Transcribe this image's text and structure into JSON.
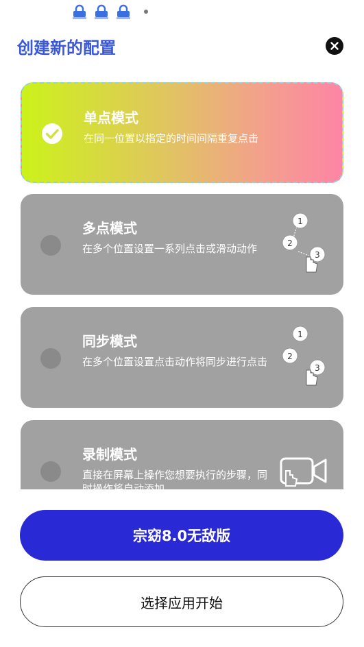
{
  "header": {
    "title": "创建新的配置",
    "close_icon": "close-icon"
  },
  "modes": [
    {
      "title": "单点模式",
      "description": "在同一位置以指定的时间间隔重复点击",
      "selected": true,
      "icon": "check-icon"
    },
    {
      "title": "多点模式",
      "description": "在多个位置设置一系列点击或滑动动作",
      "selected": false,
      "icon": "multi-tap-icon",
      "step_labels": [
        "1",
        "2",
        "3"
      ]
    },
    {
      "title": "同步模式",
      "description": "在多个位置设置点击动作将同步进行点击",
      "selected": false,
      "icon": "sync-tap-icon",
      "step_labels": [
        "1",
        "2",
        "3"
      ]
    },
    {
      "title": "录制模式",
      "description": "直接在屏幕上操作您想要执行的步骤，同时操作将自动添加",
      "selected": false,
      "icon": "record-icon"
    }
  ],
  "buttons": {
    "primary_label": "宗窈8.0无敌版",
    "secondary_label": "选择应用开始"
  },
  "colors": {
    "accent": "#2929d6",
    "title": "#3a58d8",
    "card_inactive": "#a1a1a1"
  }
}
